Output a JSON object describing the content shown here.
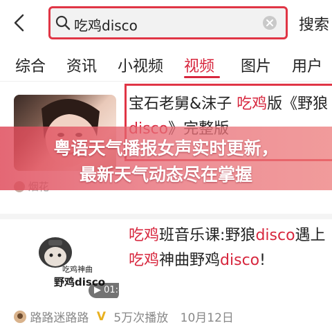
{
  "search": {
    "query": "吃鸡disco",
    "submit_label": "搜索"
  },
  "tabs": [
    {
      "label": "综合"
    },
    {
      "label": "资讯"
    },
    {
      "label": "小视频"
    },
    {
      "label": "视频"
    },
    {
      "label": "图片"
    },
    {
      "label": "用户"
    }
  ],
  "active_tab": "视频",
  "results": [
    {
      "title_parts": [
        "宝石老舅&沫子 ",
        "吃鸡",
        "版《野狼",
        "disco",
        "》完整版"
      ],
      "author": "烟花"
    },
    {
      "line1": [
        "吃鸡",
        "班音乐课:野狼",
        "disco",
        "遇上"
      ],
      "line2": [
        "吃鸡",
        "神曲野鸡",
        "disco",
        "!"
      ],
      "thumb_text": [
        "吃鸡神曲",
        "野鸡disco"
      ],
      "duration": "01:41",
      "author": "路路迷路路",
      "verified_mark": "V",
      "views": "5万次播放",
      "date": "10月12日"
    }
  ],
  "banner": {
    "line1": "粤语天气播报女声实时更新，",
    "line2": "最新天气动态尽在掌握"
  },
  "colors": {
    "accent": "#d7263d",
    "highlight_border": "#e03545"
  }
}
